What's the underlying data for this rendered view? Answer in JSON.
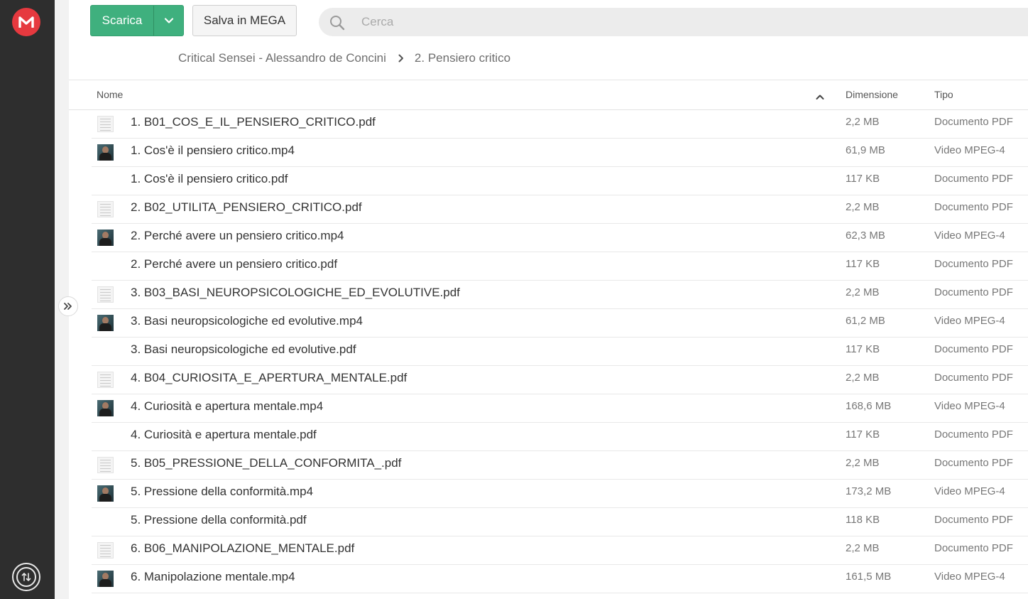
{
  "toolbar": {
    "download_label": "Scarica",
    "save_label": "Salva in MEGA",
    "search_placeholder": "Cerca"
  },
  "breadcrumb": {
    "parent": "Critical Sensei - Alessandro de Concini",
    "current": "2. Pensiero critico"
  },
  "columns": {
    "name": "Nome",
    "size": "Dimensione",
    "type": "Tipo"
  },
  "files": [
    {
      "name": "1. B01_COS_E_IL_PENSIERO_CRITICO.pdf",
      "size": "2,2 MB",
      "type": "Documento PDF",
      "thumb": "pdf"
    },
    {
      "name": "1. Cos'è il pensiero critico.mp4",
      "size": "61,9 MB",
      "type": "Video MPEG-4",
      "thumb": "video"
    },
    {
      "name": "1. Cos'è il pensiero critico.pdf",
      "size": "117 KB",
      "type": "Documento PDF",
      "thumb": "blank"
    },
    {
      "name": "2. B02_UTILITA_PENSIERO_CRITICO.pdf",
      "size": "2,2 MB",
      "type": "Documento PDF",
      "thumb": "pdf"
    },
    {
      "name": "2. Perché avere un pensiero critico.mp4",
      "size": "62,3 MB",
      "type": "Video MPEG-4",
      "thumb": "video"
    },
    {
      "name": "2. Perché avere un pensiero critico.pdf",
      "size": "117 KB",
      "type": "Documento PDF",
      "thumb": "blank"
    },
    {
      "name": "3. B03_BASI_NEUROPSICOLOGICHE_ED_EVOLUTIVE.pdf",
      "size": "2,2 MB",
      "type": "Documento PDF",
      "thumb": "pdf"
    },
    {
      "name": "3. Basi neuropsicologiche ed evolutive.mp4",
      "size": "61,2 MB",
      "type": "Video MPEG-4",
      "thumb": "video"
    },
    {
      "name": "3. Basi neuropsicologiche ed evolutive.pdf",
      "size": "117 KB",
      "type": "Documento PDF",
      "thumb": "blank"
    },
    {
      "name": "4. B04_CURIOSITA_E_APERTURA_MENTALE.pdf",
      "size": "2,2 MB",
      "type": "Documento PDF",
      "thumb": "pdf"
    },
    {
      "name": "4. Curiosità e apertura mentale.mp4",
      "size": "168,6 MB",
      "type": "Video MPEG-4",
      "thumb": "video"
    },
    {
      "name": "4. Curiosità e apertura mentale.pdf",
      "size": "117 KB",
      "type": "Documento PDF",
      "thumb": "blank"
    },
    {
      "name": "5. B05_PRESSIONE_DELLA_CONFORMITA_.pdf",
      "size": "2,2 MB",
      "type": "Documento PDF",
      "thumb": "pdf"
    },
    {
      "name": "5. Pressione della conformità.mp4",
      "size": "173,2 MB",
      "type": "Video MPEG-4",
      "thumb": "video"
    },
    {
      "name": "5. Pressione della conformità.pdf",
      "size": "118 KB",
      "type": "Documento PDF",
      "thumb": "blank"
    },
    {
      "name": "6. B06_MANIPOLAZIONE_MENTALE.pdf",
      "size": "2,2 MB",
      "type": "Documento PDF",
      "thumb": "pdf"
    },
    {
      "name": "6. Manipolazione mentale.mp4",
      "size": "161,5 MB",
      "type": "Video MPEG-4",
      "thumb": "video"
    }
  ],
  "colors": {
    "brand_red": "#e6393f",
    "download_green": "#3fb07e",
    "rail_dark": "#2e2e2e"
  },
  "icons": {
    "logo": "mega-logo-icon",
    "transfers": "transfers-icon",
    "panel_toggle": "double-chevron-right-icon",
    "search": "search-icon",
    "sort": "chevron-up-icon",
    "breadcrumb_sep": "chevron-right-icon",
    "dropdown": "chevron-down-icon"
  }
}
